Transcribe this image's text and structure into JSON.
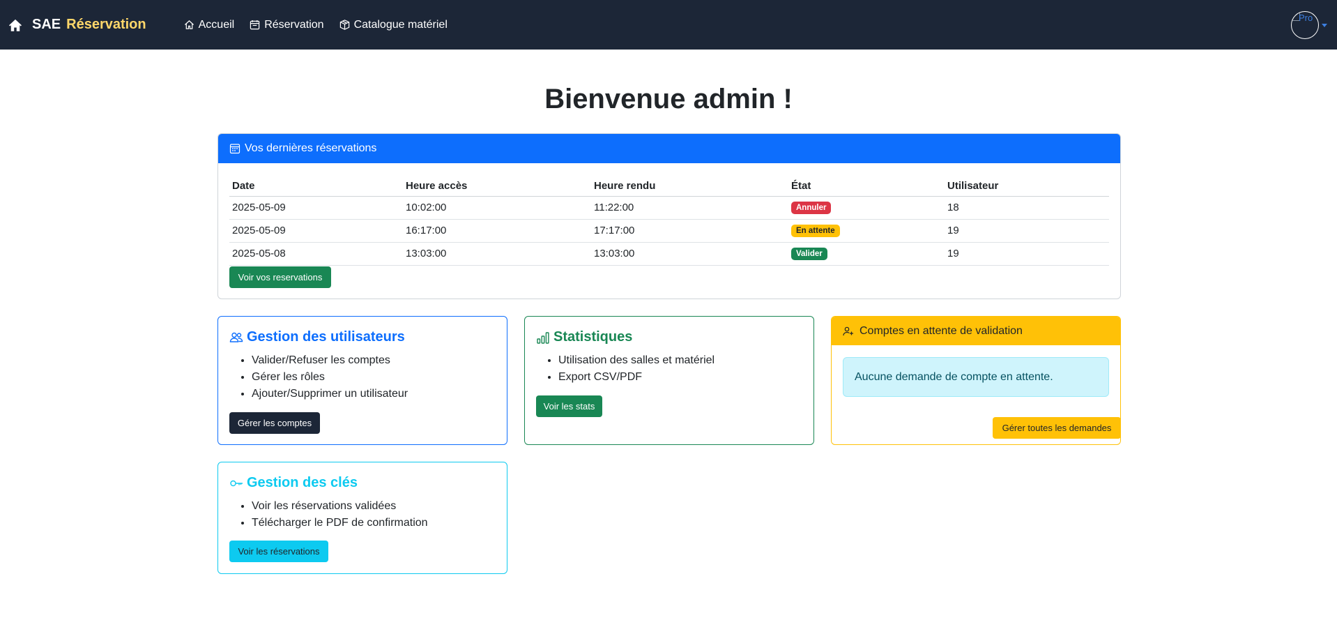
{
  "navbar": {
    "brand_part1": "SAE",
    "brand_part2": "Réservation",
    "links": [
      {
        "label": "Accueil",
        "icon": "house-icon"
      },
      {
        "label": "Réservation",
        "icon": "calendar-icon"
      },
      {
        "label": "Catalogue matériel",
        "icon": "box-icon"
      }
    ],
    "avatar_alt": "Pro"
  },
  "page": {
    "title": "Bienvenue admin !"
  },
  "reservations": {
    "header": "Vos dernières réservations",
    "columns": [
      "Date",
      "Heure accès",
      "Heure rendu",
      "État",
      "Utilisateur"
    ],
    "rows": [
      {
        "date": "2025-05-09",
        "access": "10:02:00",
        "return": "11:22:00",
        "state": "Annuler",
        "user": "18"
      },
      {
        "date": "2025-05-09",
        "access": "16:17:00",
        "return": "17:17:00",
        "state": "En attente",
        "user": "19"
      },
      {
        "date": "2025-05-08",
        "access": "13:03:00",
        "return": "13:03:00",
        "state": "Valider",
        "user": "19"
      }
    ],
    "button": "Voir vos reservations"
  },
  "users_card": {
    "title": "Gestion des utilisateurs",
    "items": [
      "Valider/Refuser les comptes",
      "Gérer les rôles",
      "Ajouter/Supprimer un utilisateur"
    ],
    "button": "Gérer les comptes"
  },
  "stats_card": {
    "title": "Statistiques",
    "items": [
      "Utilisation des salles et matériel",
      "Export CSV/PDF"
    ],
    "button": "Voir les stats"
  },
  "pending_card": {
    "header": "Comptes en attente de validation",
    "alert": "Aucune demande de compte en attente.",
    "button": "Gérer toutes les demandes"
  },
  "keys_card": {
    "title": "Gestion des clés",
    "items": [
      "Voir les réservations validées",
      "Télécharger le PDF de confirmation"
    ],
    "button": "Voir les réservations"
  },
  "colors": {
    "navbar": "#1c2637",
    "brand_accent": "#ffd76a",
    "primary": "#0d6efd",
    "success": "#198754",
    "warning": "#ffc107",
    "info": "#0dcaf0",
    "danger": "#dc3545"
  }
}
